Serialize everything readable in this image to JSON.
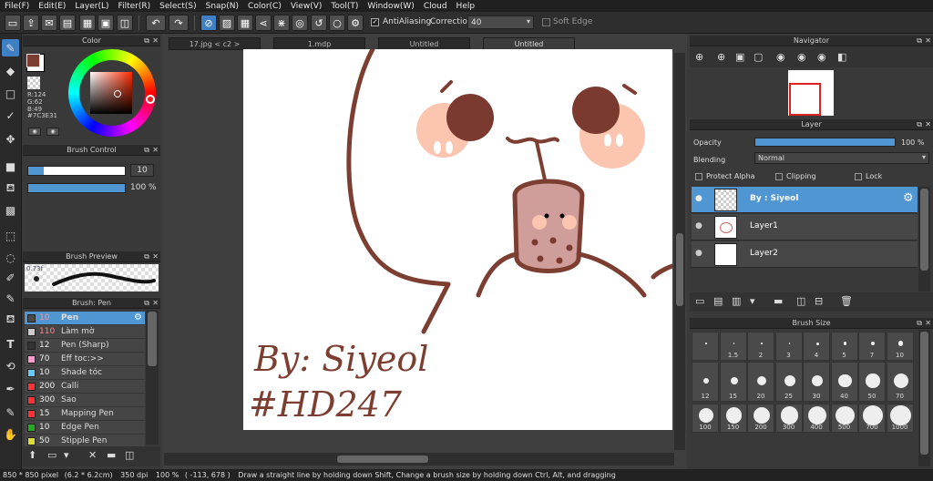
{
  "menu": [
    "File(F)",
    "Edit(E)",
    "Layer(L)",
    "Filter(R)",
    "Select(S)",
    "Snap(N)",
    "Color(C)",
    "View(V)",
    "Tool(T)",
    "Window(W)",
    "Cloud",
    "Help"
  ],
  "toolbar": {
    "antialiasing_label": "AntiAliasing",
    "correction_label": "Correction",
    "correction_value": "40",
    "soft_edge_label": "Soft Edge"
  },
  "color_panel": {
    "title": "Color",
    "r": "R:124",
    "g": "G:62",
    "b": "B:49",
    "hex": "#7C3E31",
    "foreground": "#7c3e31"
  },
  "brush_control": {
    "title": "Brush Control",
    "size": "10",
    "opacity": "100 %"
  },
  "brush_preview": {
    "title": "Brush Preview",
    "value": "0.73f"
  },
  "brush_list": {
    "title": "Brush: Pen",
    "items": [
      {
        "size": "10",
        "name": "Pen",
        "color": "#4a4a4a"
      },
      {
        "size": "110",
        "name": "Làm mờ",
        "color": "#cccccc"
      },
      {
        "size": "12",
        "name": "Pen (Sharp)",
        "color": "#333333"
      },
      {
        "size": "70",
        "name": "Eff toc:>>",
        "color": "#ff99cc"
      },
      {
        "size": "10",
        "name": "Shade tóc",
        "color": "#66ccff"
      },
      {
        "size": "200",
        "name": "Calli",
        "color": "#ff3333"
      },
      {
        "size": "300",
        "name": "Sao",
        "color": "#ff3333"
      },
      {
        "size": "15",
        "name": "Mapping Pen",
        "color": "#ff3333"
      },
      {
        "size": "10",
        "name": "Edge Pen",
        "color": "#22aa22"
      },
      {
        "size": "50",
        "name": "Stipple Pen",
        "color": "#dddd33"
      }
    ]
  },
  "tabs": [
    "17.jpg < c2 >",
    "1.mdp",
    "Untitled",
    "Untitled"
  ],
  "canvas_text": {
    "line1": "By: Siyeol",
    "line2": "#HD247"
  },
  "navigator": {
    "title": "Navigator"
  },
  "layer_panel": {
    "title": "Layer",
    "opacity_label": "Opacity",
    "opacity_value": "100 %",
    "opacity_fraction": 1.0,
    "blending_label": "Blending",
    "blending_value": "Normal",
    "protect_alpha": "Protect Alpha",
    "clipping": "Clipping",
    "lock": "Lock",
    "layers": [
      {
        "name": "By : Siyeol",
        "selected": true
      },
      {
        "name": "Layer1",
        "selected": false
      },
      {
        "name": "Layer2",
        "selected": false
      }
    ]
  },
  "brush_size": {
    "title": "Brush Size",
    "rows": [
      [
        "",
        "1.5",
        "2",
        "3",
        "4",
        "5",
        "7",
        "10"
      ],
      [
        "12",
        "15",
        "20",
        "25",
        "30",
        "40",
        "50",
        "70"
      ],
      [
        "100",
        "150",
        "200",
        "300",
        "400",
        "500",
        "700",
        "1000"
      ]
    ]
  },
  "status": {
    "dims": "850 * 850 pixel",
    "physical": "(6.2 * 6.2cm)",
    "dpi": "350 dpi",
    "zoom": "100 %",
    "coords": "( -113, 678 )",
    "hint": "Draw a straight line by holding down Shift, Change a brush size by holding down Ctrl, Alt, and dragging"
  }
}
